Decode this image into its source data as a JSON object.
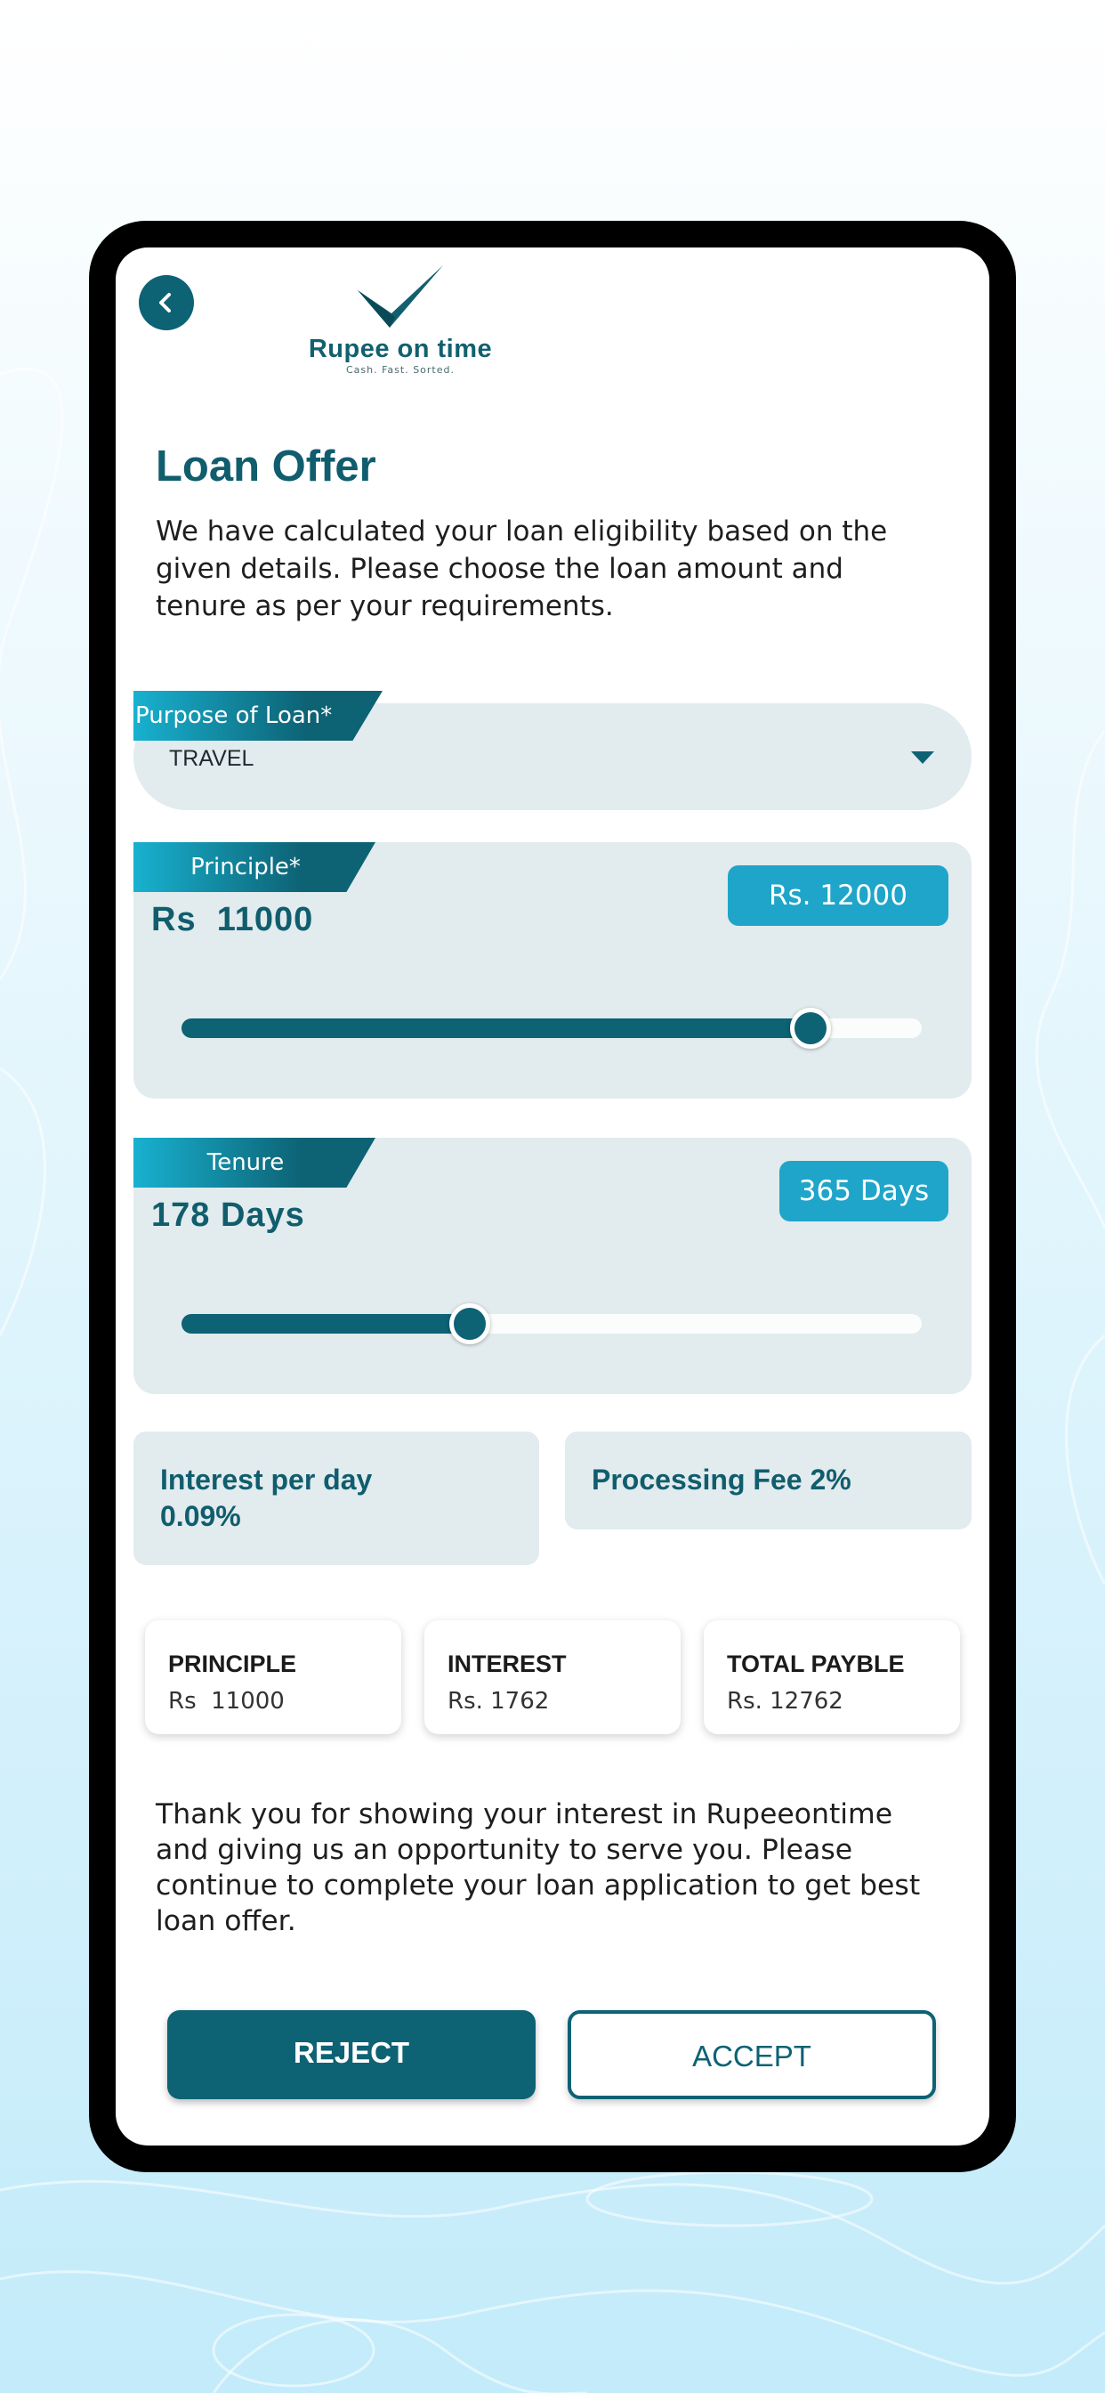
{
  "header": {
    "back_icon": "chevron-left-icon",
    "brand_name": "Rupee on time",
    "brand_tagline": "Cash. Fast. Sorted."
  },
  "page": {
    "title": "Loan Offer",
    "intro": "We have calculated your loan eligibility based on the given details. Please choose the loan amount and tenure as per your requirements."
  },
  "purpose": {
    "label": "Purpose of Loan*",
    "value": "TRAVEL"
  },
  "principle_slider": {
    "label": "Principle*",
    "value": "Rs  11000",
    "max_label": "Rs. 12000",
    "level": 0.85
  },
  "tenure_slider": {
    "label": "Tenure",
    "value": "178 Days",
    "max_label": "365 Days",
    "level": 0.39
  },
  "rates": {
    "interest_label": "Interest per day",
    "interest_value": "0.09%",
    "processing_fee": "Processing Fee 2%"
  },
  "summary": [
    {
      "title": "PRINCIPLE",
      "value": "Rs  11000"
    },
    {
      "title": "INTEREST",
      "value": "Rs. 1762"
    },
    {
      "title": "TOTAL PAYBLE",
      "value": "Rs. 12762"
    }
  ],
  "closing_text": "Thank you for showing your interest in Rupeeontime and giving us an opportunity to serve you. Please continue to complete your loan application to get best loan offer.",
  "actions": {
    "reject": "REJECT",
    "accept": "ACCEPT"
  },
  "colors": {
    "brand_dark": "#0d6274",
    "brand_light": "#1fa5c9",
    "card_bg": "#e2ebed"
  }
}
